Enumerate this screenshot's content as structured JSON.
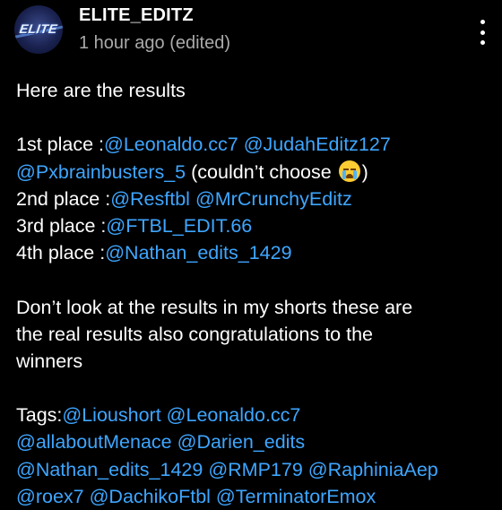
{
  "header": {
    "author": "ELITE_EDITZ",
    "meta": "1 hour ago (edited)",
    "avatar_text": "ELITE"
  },
  "post": {
    "intro": "Here are the results",
    "first_label": "1st place :",
    "first_mention_1": "@Leonaldo.cc7",
    "first_mention_2": "@JudahEditz127",
    "first_mention_3": "@Pxbrainbusters_5",
    "first_note_open": " (couldn’t choose ",
    "first_note_close": ")",
    "second_label": "2nd place :",
    "second_mention_1": "@Resftbl",
    "second_mention_2": "@MrCrunchyEditz",
    "third_label": "3rd place :",
    "third_mention_1": "@FTBL_EDIT.66",
    "fourth_label": "4th place :",
    "fourth_mention_1": "@Nathan_edits_1429",
    "para_line1": "Don’t look at the results in my shorts these are",
    "para_line2": "the real results also congratulations to the",
    "para_line3": "winners",
    "tags_label": "Tags:",
    "tags": [
      "@Lioushort",
      "@Leonaldo.cc7",
      "@allaboutMenace",
      "@Darien_edits",
      "@Nathan_edits_1429",
      "@RMP179",
      "@RaphiniaAep",
      "@roex7",
      "@DachikoFtbl",
      "@TerminatorEmox"
    ]
  },
  "icons": {
    "more": "more-vertical-icon",
    "emoji": "loudly-crying-face-emoji"
  },
  "colors": {
    "background": "#000000",
    "text": "#ffffff",
    "meta": "#aaaaaa",
    "mention": "#3ea6ff"
  }
}
